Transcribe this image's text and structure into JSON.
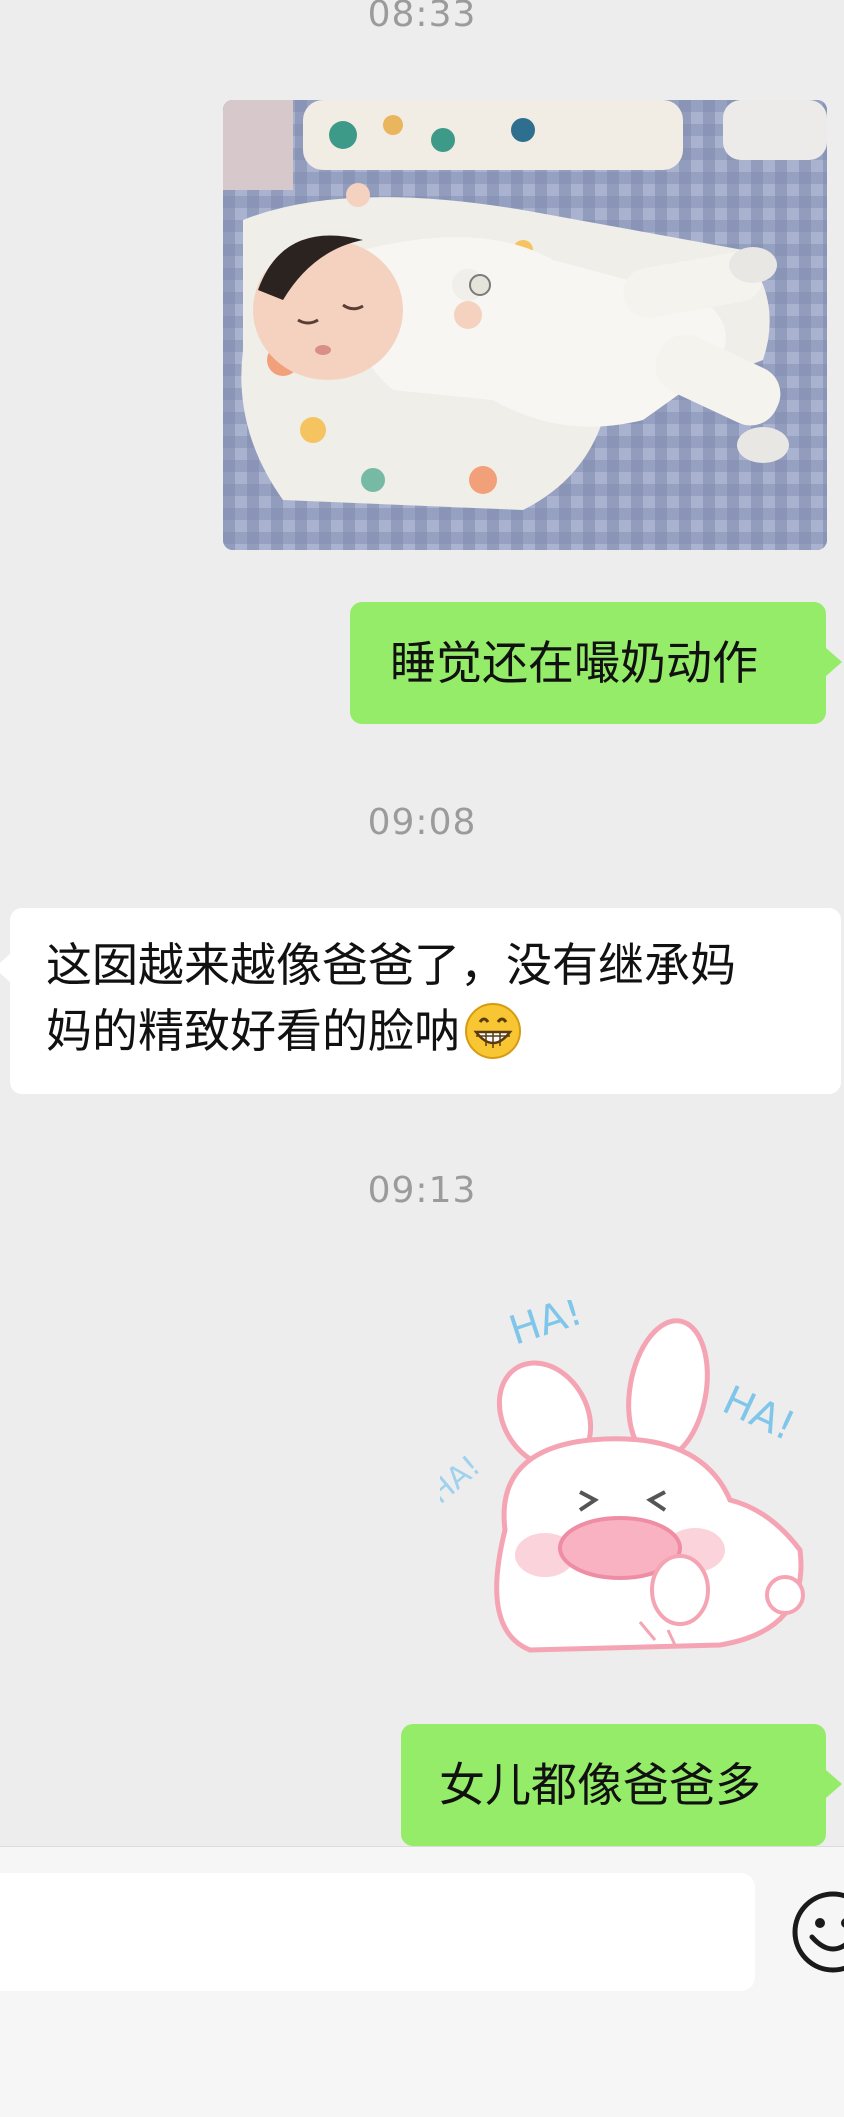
{
  "chat": {
    "timestamps": [
      "08:33",
      "09:08",
      "09:13"
    ],
    "messages": {
      "m1": "睡觉还在嘬奶动作",
      "m2_line1": "这囡越来越像爸爸了，没有继承妈",
      "m2_line2": "妈的精致好看的脸呐",
      "m2_emoji": "grinning-face-emoji",
      "m3": "女儿都像爸爸多"
    },
    "sticker": {
      "icon": "laughing-bunny-sticker",
      "text_left": "HA!",
      "text_right": "HA!",
      "text_side": "HA!"
    },
    "photo": {
      "icon": "sleeping-baby-photo"
    }
  },
  "input": {
    "text": "",
    "emoji_icon": "smiley-face-icon"
  },
  "colors": {
    "background": "#ededed",
    "my_bubble": "#95ec69",
    "their_bubble": "#ffffff",
    "timestamp": "#9b9b9b"
  }
}
